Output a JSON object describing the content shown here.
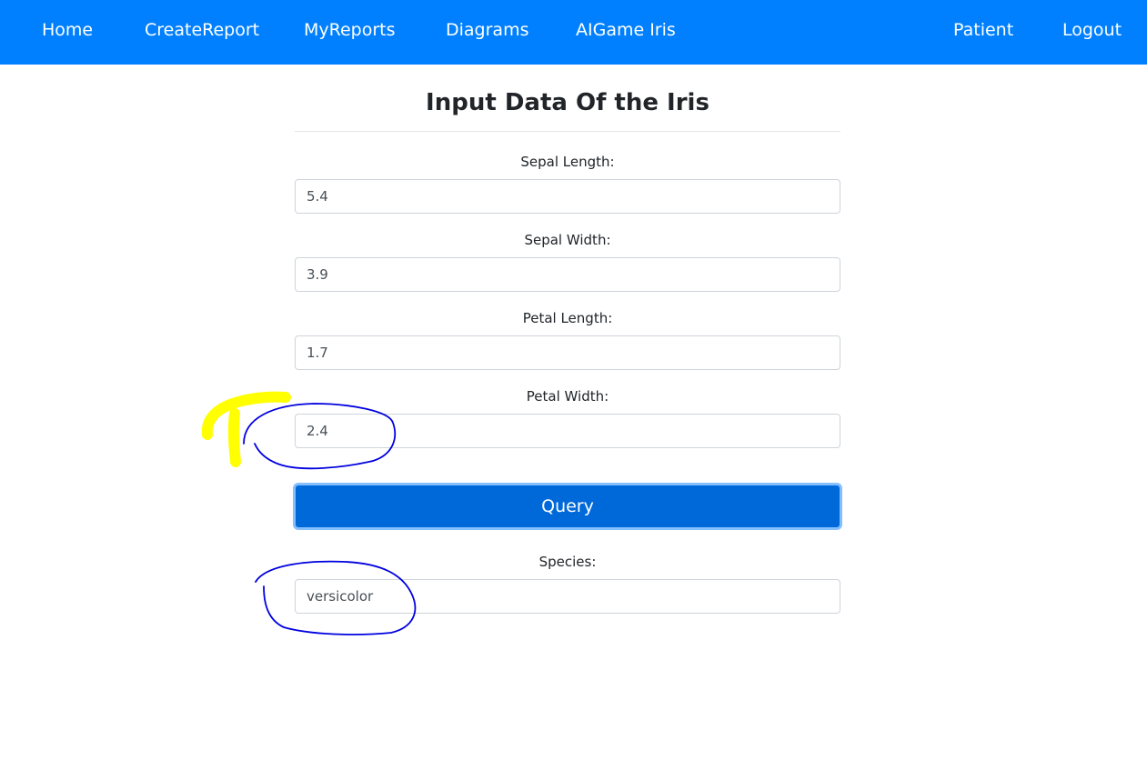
{
  "nav": {
    "left_items": [
      "Home",
      "CreateReport",
      "MyReports",
      "Diagrams",
      "AIGame Iris"
    ],
    "right_items": [
      "Patient",
      "Logout"
    ]
  },
  "form": {
    "title": "Input Data Of the Iris",
    "fields": [
      {
        "label": "Sepal Length:",
        "value": "5.4"
      },
      {
        "label": "Sepal Width:",
        "value": "3.9"
      },
      {
        "label": "Petal Length:",
        "value": "1.7"
      },
      {
        "label": "Petal Width:",
        "value": "2.4"
      }
    ],
    "query_label": "Query",
    "result": {
      "label": "Species:",
      "value": "versicolor"
    }
  },
  "colors": {
    "navbar": "#0080ff",
    "button": "#0069d9",
    "annotation_circle": "#0000e0",
    "annotation_highlight": "#ffff00"
  }
}
